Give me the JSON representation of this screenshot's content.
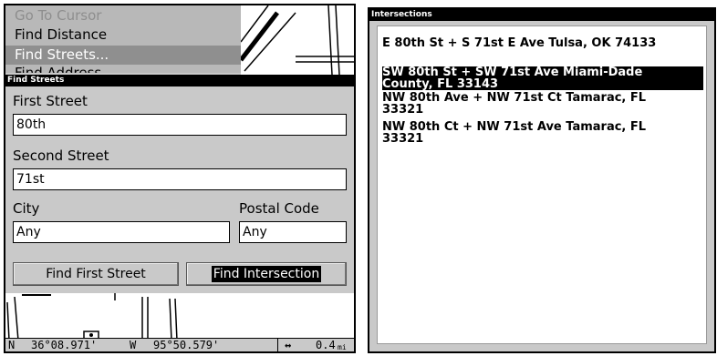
{
  "left_panel": {
    "menu": {
      "items": [
        {
          "label": "Go To Cursor",
          "state": "disabled"
        },
        {
          "label": "Find Distance",
          "state": "normal"
        },
        {
          "label": "Find Streets...",
          "state": "selected"
        },
        {
          "label": "Find Address",
          "state": "partially-hidden"
        }
      ]
    },
    "dialog": {
      "title": "Find Streets",
      "first_street_label": "First Street",
      "first_street_value": "80th",
      "second_street_label": "Second Street",
      "second_street_value": "71st",
      "city_label": "City",
      "city_value": "Any",
      "postal_code_label": "Postal Code",
      "postal_code_value": "Any",
      "find_first_street_button": "Find First Street",
      "find_intersection_button": "Find Intersection"
    },
    "status_bar": {
      "lat_hemisphere": "N",
      "latitude": "36°08.971'",
      "lon_hemisphere": "W",
      "longitude": "95°50.579'",
      "distance_icon": "horizontal-arrows-icon",
      "distance_value": "0.4",
      "distance_unit": "mi"
    }
  },
  "right_panel": {
    "title": "Intersections",
    "results": [
      {
        "line1": "E 80th St + S 71st E Ave Tulsa, OK  74133",
        "line2": "",
        "selected": false
      },
      {
        "line1": "SW 80th St + SW 71st Ave Miami-Dade",
        "line2": "County, FL  33143",
        "selected": true
      },
      {
        "line1": "NW 80th Ave + NW 71st Ct Tamarac, FL",
        "line2": "33321",
        "selected": false
      },
      {
        "line1": "NW 80th Ct + NW 71st Ave Tamarac, FL",
        "line2": "33321",
        "selected": false
      }
    ]
  }
}
